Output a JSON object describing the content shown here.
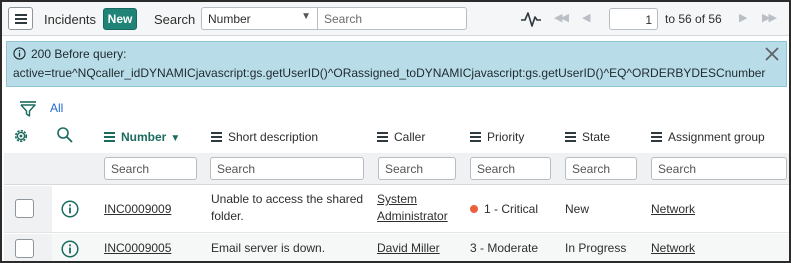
{
  "header": {
    "title": "Incidents",
    "new_label": "New",
    "search_label": "Search",
    "search_field": "Number",
    "search_placeholder": "Search",
    "page_current": "1",
    "page_of": "to 56 of 56"
  },
  "banner": {
    "line1": "200 Before query:",
    "line2": "active=true^NQcaller_idDYNAMICjavascript:gs.getUserID()^ORassigned_toDYNAMICjavascript:gs.getUserID()^EQ^ORDERBYDESCnumber"
  },
  "filter": {
    "all_label": "All"
  },
  "columns": [
    {
      "label": "Number",
      "sorted": "desc"
    },
    {
      "label": "Short description"
    },
    {
      "label": "Caller"
    },
    {
      "label": "Priority"
    },
    {
      "label": "State"
    },
    {
      "label": "Assignment group"
    }
  ],
  "column_search_placeholder": "Search",
  "rows": [
    {
      "number": "INC0009009",
      "short_description": "Unable to access the shared folder.",
      "caller": "System Administrator",
      "priority": "1 - Critical",
      "state": "New",
      "assignment_group": "Network"
    },
    {
      "number": "INC0009005",
      "short_description": "Email server is down.",
      "caller": "David Miller",
      "priority": "3 - Moderate",
      "state": "In Progress",
      "assignment_group": "Network"
    }
  ],
  "colors": {
    "new_button": "#1f8476",
    "banner_bg": "#b9dde8",
    "sorted_header": "#1b6b5f",
    "critical_dot": "#e8603c",
    "filter_link": "#1f6ad0"
  },
  "icons": {
    "menu": "hamburger-icon",
    "activity": "activity-pulse-icon",
    "pager": [
      "first-page-icon",
      "prev-page-icon",
      "next-page-icon",
      "last-page-icon"
    ],
    "info": "info-circle-icon",
    "close": "close-icon",
    "filter": "filter-funnel-icon",
    "settings": "gear-icon",
    "search": "search-icon"
  }
}
